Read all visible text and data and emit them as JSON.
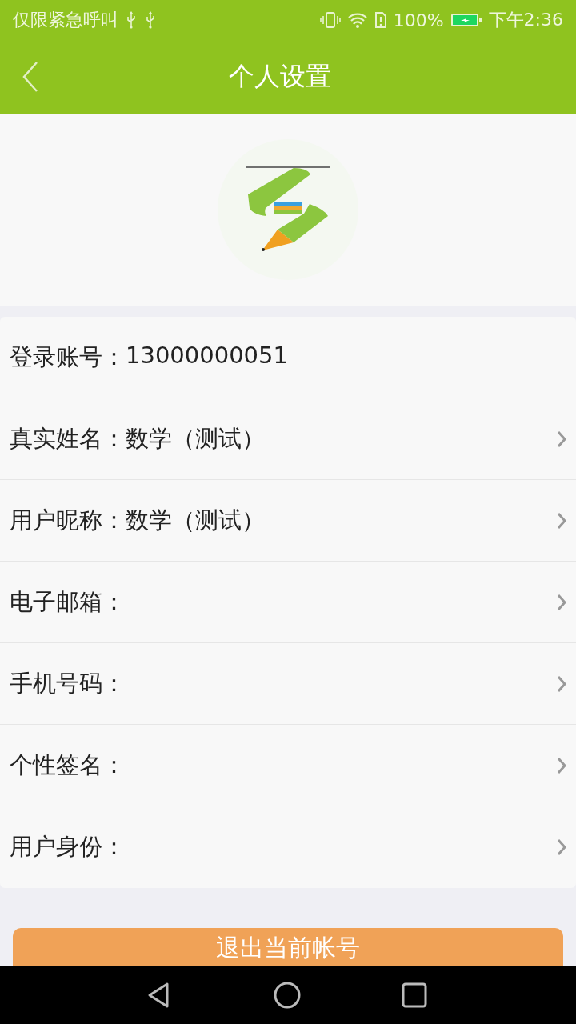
{
  "status_bar": {
    "left_text": "仅限紧急呼叫",
    "battery": "100%",
    "time": "下午2:36"
  },
  "header": {
    "title": "个人设置"
  },
  "fields": [
    {
      "label": "登录账号：",
      "value": "13000000051",
      "arrow": false
    },
    {
      "label": "真实姓名：",
      "value": "数学（测试）",
      "arrow": true
    },
    {
      "label": "用户昵称：",
      "value": "数学（测试）",
      "arrow": true
    },
    {
      "label": "电子邮箱：",
      "arrow": true
    },
    {
      "label": "手机号码：",
      "arrow": true
    },
    {
      "label": "个性签名：",
      "arrow": true
    },
    {
      "label": "用户身份：",
      "arrow": true
    }
  ],
  "logout_button": "退出当前帐号"
}
